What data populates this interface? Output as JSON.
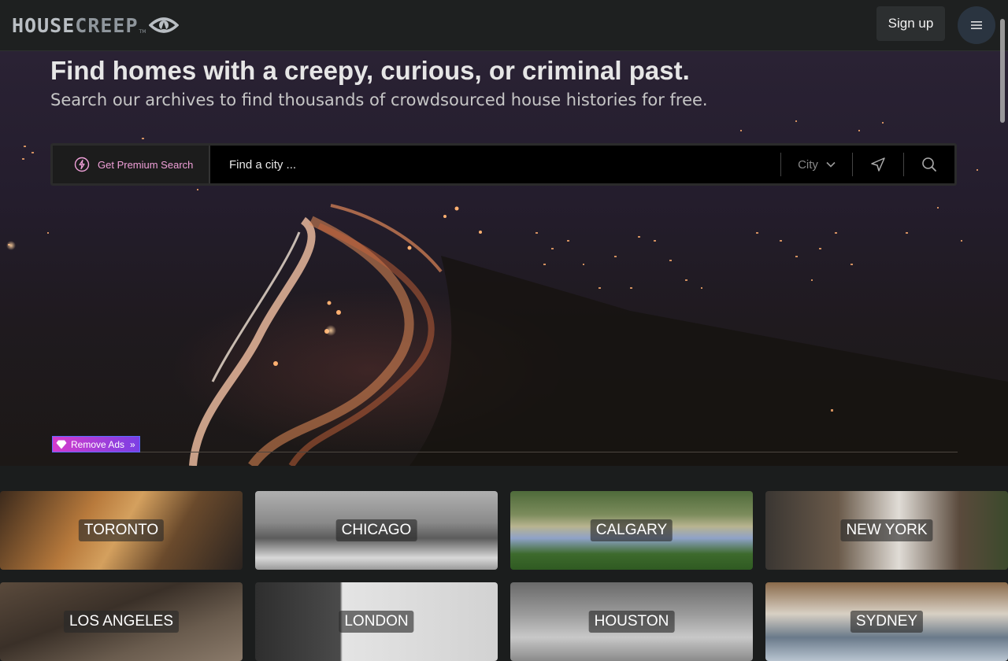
{
  "header": {
    "logo_house": "HOUSE",
    "logo_creep": "CREEP",
    "logo_tm": "TM",
    "signup_label": "Sign up",
    "menu_icon": "hamburger-icon"
  },
  "hero": {
    "title": "Find homes with a creepy, curious, or criminal past.",
    "subtitle": "Search our archives to find thousands of crowdsourced house histories for free.",
    "premium_label": "Get Premium Search",
    "premium_icon": "lightning-icon",
    "search_placeholder": "Find a city ...",
    "select_label": "City",
    "geo_icon": "location-arrow-icon",
    "search_icon": "search-icon",
    "remove_ads_label": "Remove Ads",
    "remove_ads_chevron": "»"
  },
  "cities": [
    {
      "name": "TORONTO"
    },
    {
      "name": "CHICAGO"
    },
    {
      "name": "CALGARY"
    },
    {
      "name": "NEW YORK"
    },
    {
      "name": "LOS ANGELES"
    },
    {
      "name": "LONDON"
    },
    {
      "name": "HOUSTON"
    },
    {
      "name": "SYDNEY"
    }
  ],
  "colors": {
    "accent_pink": "#f0a0d8",
    "header_bg": "#1e2020",
    "page_bg": "#1b1d1d"
  }
}
